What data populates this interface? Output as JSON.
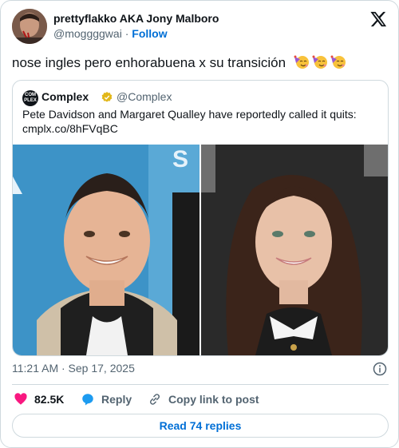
{
  "author": {
    "display_name": "prettyflakko AKA Jony Malboro",
    "handle": "@moggggwai",
    "separator": "·",
    "follow_label": "Follow"
  },
  "tweet": {
    "text": "nose ingles pero enhorabuena x su transición",
    "emoji_icons": [
      "partying-face-icon",
      "partying-face-icon",
      "partying-face-icon"
    ]
  },
  "quoted": {
    "avatar_text": "COM PLEX",
    "display_name": "Complex",
    "handle": "@Complex",
    "text": "Pete Davidson and Margaret Qualley have reportedly called it quits:",
    "link": "cmplx.co/8hFVqBC"
  },
  "timestamp": "11:21 AM · Sep 17, 2025",
  "actions": {
    "like_count": "82.5K",
    "reply_label": "Reply",
    "copy_label": "Copy link to post"
  },
  "replies_button": "Read 74 replies",
  "colors": {
    "accent": "#006fd6",
    "like": "#f91880",
    "reply": "#1d9bf0",
    "text_secondary": "#536471",
    "border": "#cfd9de"
  }
}
